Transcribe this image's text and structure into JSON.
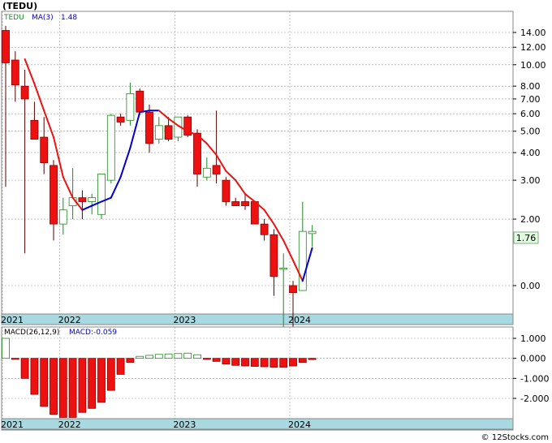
{
  "title": "(TEDU)",
  "footer": "© 12Stocks.com",
  "colors": {
    "up": "#ffffff",
    "up_border": "#228822",
    "down": "#ee1111",
    "ma_up": "#0000cc",
    "ma_down": "#ee1111",
    "grid": "#999999",
    "axis_band": "#a8d8e0",
    "last_badge": "#dfffdf"
  },
  "chart_data": [
    {
      "type": "candlestick",
      "legend": {
        "symbol": "TEDU",
        "ma_label": "MA(3)",
        "ma_value": "1.48"
      },
      "y_scale": "log",
      "y_ticks": [
        {
          "v": 14.0,
          "label": "14.00"
        },
        {
          "v": 12.0,
          "label": "12.00"
        },
        {
          "v": 10.0,
          "label": "10.00"
        },
        {
          "v": 8.0,
          "label": "8.00"
        },
        {
          "v": 7.0,
          "label": "7.00"
        },
        {
          "v": 6.0,
          "label": "6.00"
        },
        {
          "v": 5.0,
          "label": "5.00"
        },
        {
          "v": 4.0,
          "label": "4.00"
        },
        {
          "v": 3.0,
          "label": "3.00"
        },
        {
          "v": 2.0,
          "label": "2.00"
        },
        {
          "v": 1.0,
          "label": "0.00"
        }
      ],
      "last_value": "1.76",
      "x_labels": [
        {
          "i": 0,
          "label": "2021"
        },
        {
          "i": 6,
          "label": "2022"
        },
        {
          "i": 18,
          "label": "2023"
        },
        {
          "i": 30,
          "label": "2024"
        }
      ],
      "candles": [
        {
          "o": 14.3,
          "h": 15.0,
          "l": 2.8,
          "c": 10.2
        },
        {
          "o": 10.5,
          "h": 11.5,
          "l": 6.8,
          "c": 8.1
        },
        {
          "o": 8.0,
          "h": 9.5,
          "l": 1.4,
          "c": 7.0
        },
        {
          "o": 5.6,
          "h": 6.8,
          "l": 4.6,
          "c": 4.6
        },
        {
          "o": 4.7,
          "h": 5.8,
          "l": 3.2,
          "c": 3.6
        },
        {
          "o": 3.5,
          "h": 3.7,
          "l": 1.6,
          "c": 1.9
        },
        {
          "o": 1.9,
          "h": 2.5,
          "l": 1.7,
          "c": 2.2
        },
        {
          "o": 2.3,
          "h": 3.4,
          "l": 2.0,
          "c": 2.5
        },
        {
          "o": 2.5,
          "h": 2.7,
          "l": 2.0,
          "c": 2.4
        },
        {
          "o": 2.4,
          "h": 2.6,
          "l": 2.1,
          "c": 2.5
        },
        {
          "o": 2.1,
          "h": 3.2,
          "l": 2.0,
          "c": 3.2
        },
        {
          "o": 3.0,
          "h": 6.0,
          "l": 2.9,
          "c": 5.9
        },
        {
          "o": 5.8,
          "h": 6.0,
          "l": 5.3,
          "c": 5.5
        },
        {
          "o": 5.6,
          "h": 8.3,
          "l": 5.3,
          "c": 7.4
        },
        {
          "o": 7.6,
          "h": 7.8,
          "l": 5.9,
          "c": 6.1
        },
        {
          "o": 6.1,
          "h": 6.6,
          "l": 4.0,
          "c": 4.4
        },
        {
          "o": 4.6,
          "h": 5.8,
          "l": 4.4,
          "c": 5.3
        },
        {
          "o": 5.3,
          "h": 5.8,
          "l": 4.5,
          "c": 4.6
        },
        {
          "o": 4.7,
          "h": 5.8,
          "l": 4.5,
          "c": 5.8
        },
        {
          "o": 5.8,
          "h": 5.9,
          "l": 4.7,
          "c": 4.8
        },
        {
          "o": 4.9,
          "h": 5.1,
          "l": 2.8,
          "c": 3.2
        },
        {
          "o": 3.1,
          "h": 3.8,
          "l": 3.0,
          "c": 3.4
        },
        {
          "o": 3.5,
          "h": 6.2,
          "l": 2.9,
          "c": 3.2
        },
        {
          "o": 3.0,
          "h": 3.1,
          "l": 2.3,
          "c": 2.4
        },
        {
          "o": 2.4,
          "h": 2.5,
          "l": 2.3,
          "c": 2.3
        },
        {
          "o": 2.4,
          "h": 2.6,
          "l": 2.2,
          "c": 2.3
        },
        {
          "o": 2.4,
          "h": 2.4,
          "l": 1.9,
          "c": 1.9
        },
        {
          "o": 1.9,
          "h": 2.0,
          "l": 1.6,
          "c": 1.7
        },
        {
          "o": 1.7,
          "h": 1.8,
          "l": 0.9,
          "c": 1.1
        },
        {
          "o": 1.2,
          "h": 1.4,
          "l": 0.6,
          "c": 1.2
        },
        {
          "o": 1.0,
          "h": 1.05,
          "l": 0.6,
          "c": 0.93
        },
        {
          "o": 0.95,
          "h": 2.4,
          "l": 0.95,
          "c": 1.76
        },
        {
          "o": 1.72,
          "h": 1.88,
          "l": 1.5,
          "c": 1.76
        }
      ],
      "ma": [
        null,
        null,
        10.6,
        8.2,
        6.2,
        4.7,
        3.1,
        2.5,
        2.2,
        2.3,
        2.4,
        2.5,
        3.1,
        4.2,
        6.1,
        6.2,
        6.2,
        5.7,
        5.3,
        5.0,
        4.8,
        4.4,
        3.9,
        3.3,
        3.0,
        2.6,
        2.4,
        2.2,
        1.9,
        1.6,
        1.3,
        1.05,
        1.48
      ]
    },
    {
      "type": "bar",
      "legend": {
        "label": "MACD(26,12,9)",
        "value_label": "MACD:-0.059"
      },
      "y_ticks": [
        {
          "v": 1.0,
          "label": "1.000"
        },
        {
          "v": 0.0,
          "label": "0.000"
        },
        {
          "v": -1.0,
          "label": "-1.000"
        },
        {
          "v": -2.0,
          "label": "-2.000"
        }
      ],
      "x_labels": [
        {
          "i": 0,
          "label": "2021"
        },
        {
          "i": 6,
          "label": "2022"
        },
        {
          "i": 18,
          "label": "2023"
        },
        {
          "i": 30,
          "label": "2024"
        }
      ],
      "values": [
        1.0,
        -0.02,
        -1.0,
        -1.8,
        -2.4,
        -2.8,
        -2.95,
        -2.95,
        -2.7,
        -2.5,
        -2.2,
        -1.6,
        -0.8,
        -0.2,
        0.1,
        0.15,
        0.2,
        0.22,
        0.24,
        0.26,
        0.18,
        -0.05,
        -0.15,
        -0.28,
        -0.35,
        -0.38,
        -0.4,
        -0.42,
        -0.44,
        -0.44,
        -0.38,
        -0.2,
        -0.06
      ]
    }
  ]
}
